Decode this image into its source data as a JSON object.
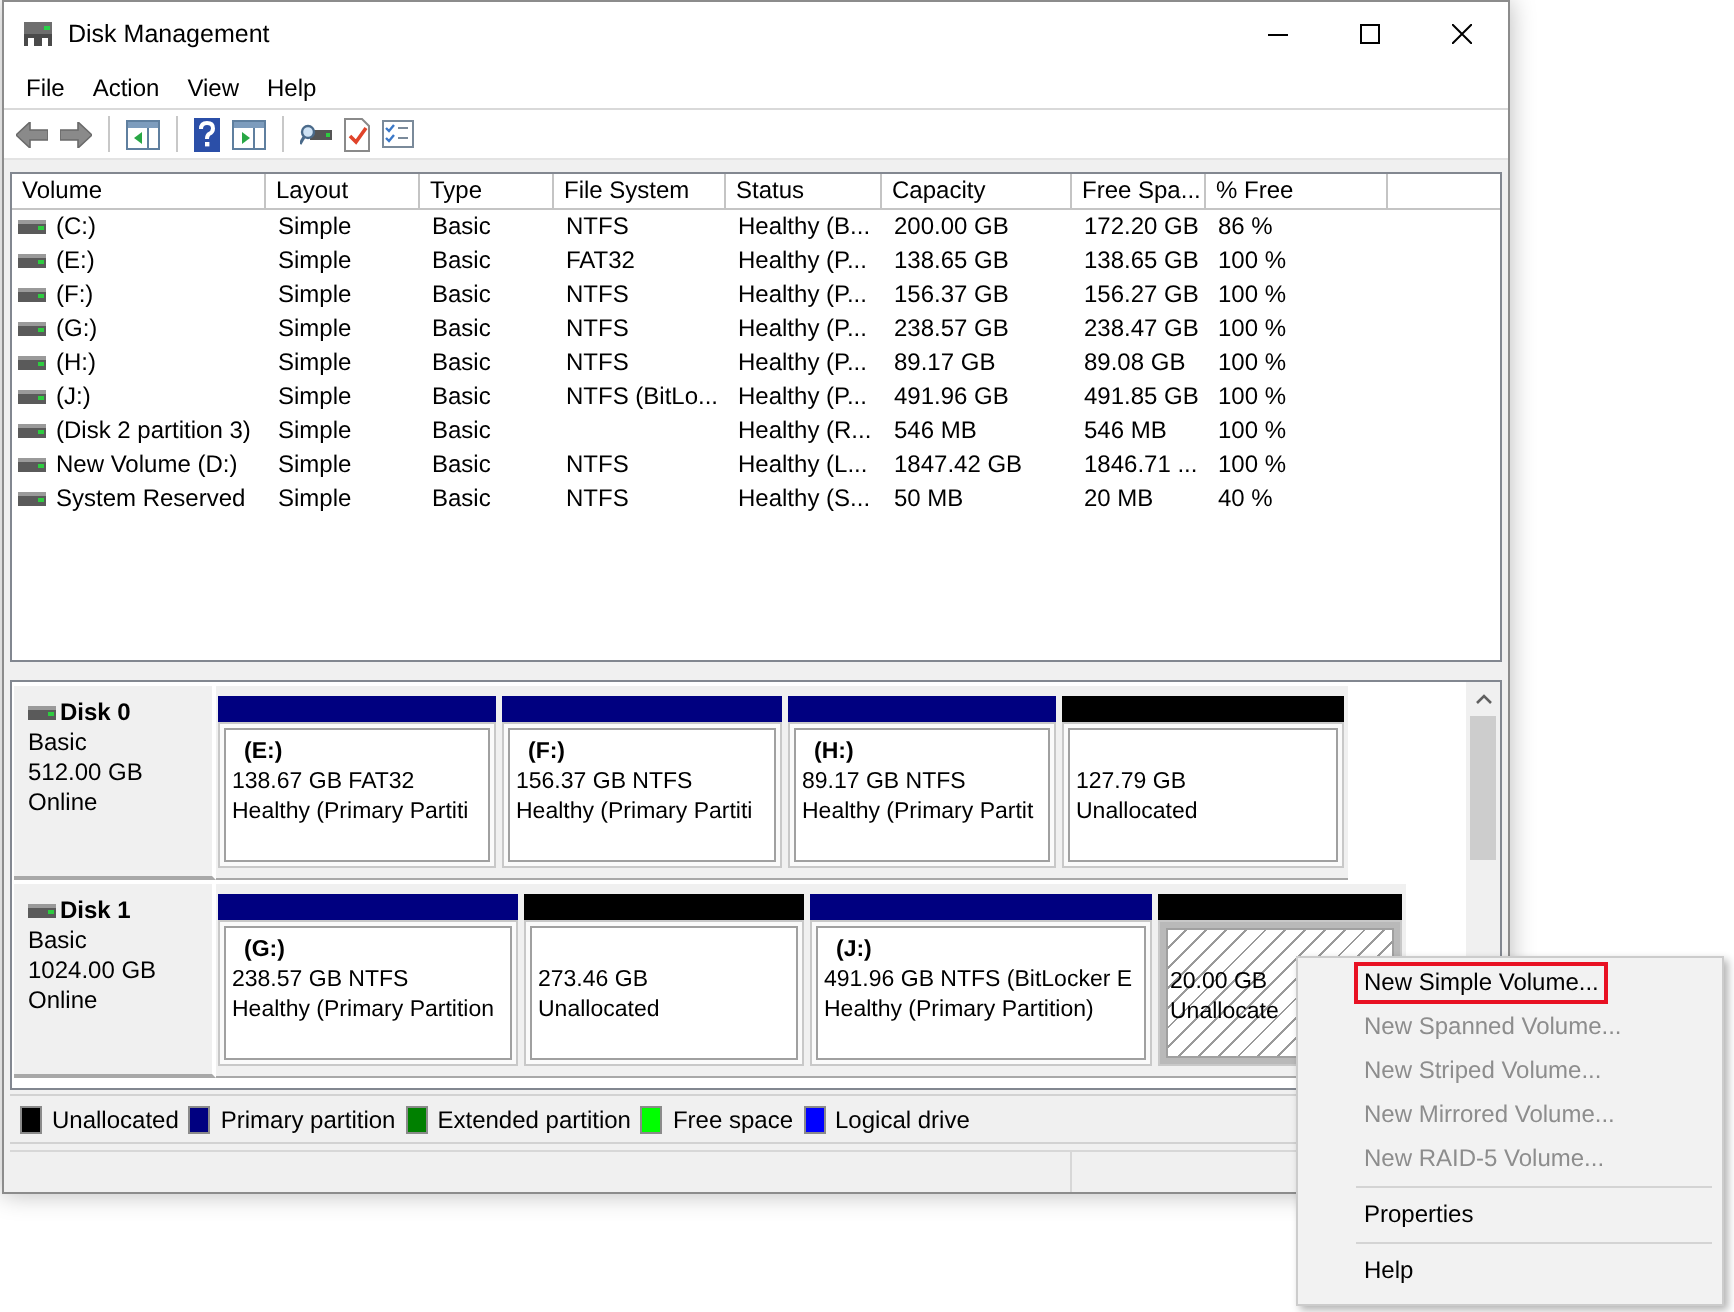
{
  "window": {
    "title": "Disk Management"
  },
  "menu": [
    "File",
    "Action",
    "View",
    "Help"
  ],
  "volumes": {
    "columns": [
      "Volume",
      "Layout",
      "Type",
      "File System",
      "Status",
      "Capacity",
      "Free Spa...",
      "% Free"
    ],
    "rows": [
      {
        "volume": "(C:)",
        "layout": "Simple",
        "type": "Basic",
        "file_system": "NTFS",
        "status": "Healthy (B...",
        "capacity": "200.00 GB",
        "free_space": "172.20 GB",
        "percent_free": "86 %"
      },
      {
        "volume": "(E:)",
        "layout": "Simple",
        "type": "Basic",
        "file_system": "FAT32",
        "status": "Healthy (P...",
        "capacity": "138.65 GB",
        "free_space": "138.65 GB",
        "percent_free": "100 %"
      },
      {
        "volume": "(F:)",
        "layout": "Simple",
        "type": "Basic",
        "file_system": "NTFS",
        "status": "Healthy (P...",
        "capacity": "156.37 GB",
        "free_space": "156.27 GB",
        "percent_free": "100 %"
      },
      {
        "volume": "(G:)",
        "layout": "Simple",
        "type": "Basic",
        "file_system": "NTFS",
        "status": "Healthy (P...",
        "capacity": "238.57 GB",
        "free_space": "238.47 GB",
        "percent_free": "100 %"
      },
      {
        "volume": "(H:)",
        "layout": "Simple",
        "type": "Basic",
        "file_system": "NTFS",
        "status": "Healthy (P...",
        "capacity": "89.17 GB",
        "free_space": "89.08 GB",
        "percent_free": "100 %"
      },
      {
        "volume": "(J:)",
        "layout": "Simple",
        "type": "Basic",
        "file_system": "NTFS (BitLo...",
        "status": "Healthy (P...",
        "capacity": "491.96 GB",
        "free_space": "491.85 GB",
        "percent_free": "100 %"
      },
      {
        "volume": "(Disk 2 partition 3)",
        "layout": "Simple",
        "type": "Basic",
        "status": "Healthy (R...",
        "capacity": "546 MB",
        "free_space": "546 MB",
        "percent_free": "100 %"
      },
      {
        "volume": "New Volume (D:)",
        "layout": "Simple",
        "type": "Basic",
        "file_system": "NTFS",
        "status": "Healthy (L...",
        "capacity": "1847.42 GB",
        "free_space": "1846.71 ...",
        "percent_free": "100 %"
      },
      {
        "volume": "System Reserved",
        "layout": "Simple",
        "type": "Basic",
        "file_system": "NTFS",
        "status": "Healthy (S...",
        "capacity": "50 MB",
        "free_space": "20 MB",
        "percent_free": "40 %"
      }
    ]
  },
  "disks": [
    {
      "name": "Disk 0",
      "type": "Basic",
      "size": "512.00 GB",
      "status": "Online",
      "partitions": [
        {
          "kind": "primary",
          "label": "(E:)",
          "size": "138.67 GB FAT32",
          "status": "Healthy (Primary Partiti",
          "selected": false
        },
        {
          "kind": "primary",
          "label": "(F:)",
          "size": "156.37 GB NTFS",
          "status": "Healthy (Primary Partiti",
          "selected": false
        },
        {
          "kind": "primary",
          "label": "(H:)",
          "size": "89.17 GB NTFS",
          "status": "Healthy (Primary Partit",
          "selected": false
        },
        {
          "kind": "unallocated",
          "size": "127.79 GB",
          "status": "Unallocated",
          "selected": false
        }
      ]
    },
    {
      "name": "Disk 1",
      "type": "Basic",
      "size": "1024.00 GB",
      "status": "Online",
      "partitions": [
        {
          "kind": "primary",
          "label": "(G:)",
          "size": "238.57 GB NTFS",
          "status": "Healthy (Primary Partition",
          "selected": false
        },
        {
          "kind": "unallocated",
          "size": "273.46 GB",
          "status": "Unallocated",
          "selected": false
        },
        {
          "kind": "primary",
          "label": "(J:)",
          "size": "491.96 GB NTFS (BitLocker E",
          "status": "Healthy (Primary Partition)",
          "selected": false
        },
        {
          "kind": "unallocated",
          "size": "20.00 GB",
          "status": "Unallocate",
          "selected": true
        }
      ]
    }
  ],
  "legend": [
    {
      "label": "Unallocated",
      "color": "#000000"
    },
    {
      "label": "Primary partition",
      "color": "#000080"
    },
    {
      "label": "Extended partition",
      "color": "#008000"
    },
    {
      "label": "Free space",
      "color": "#00ff00"
    },
    {
      "label": "Logical drive",
      "color": "#0000ff"
    }
  ],
  "context_menu": [
    {
      "kind": "item",
      "label": "New Simple Volume...",
      "disabled": false,
      "highlighted": true
    },
    {
      "kind": "item",
      "label": "New Spanned Volume...",
      "disabled": true,
      "highlighted": false
    },
    {
      "kind": "item",
      "label": "New Striped Volume...",
      "disabled": true,
      "highlighted": false
    },
    {
      "kind": "item",
      "label": "New Mirrored Volume...",
      "disabled": true,
      "highlighted": false
    },
    {
      "kind": "item",
      "label": "New RAID-5 Volume...",
      "disabled": true,
      "highlighted": false
    },
    {
      "kind": "separator"
    },
    {
      "kind": "item",
      "label": "Properties",
      "disabled": false,
      "highlighted": false
    },
    {
      "kind": "separator"
    },
    {
      "kind": "item",
      "label": "Help",
      "disabled": false,
      "highlighted": false
    }
  ]
}
